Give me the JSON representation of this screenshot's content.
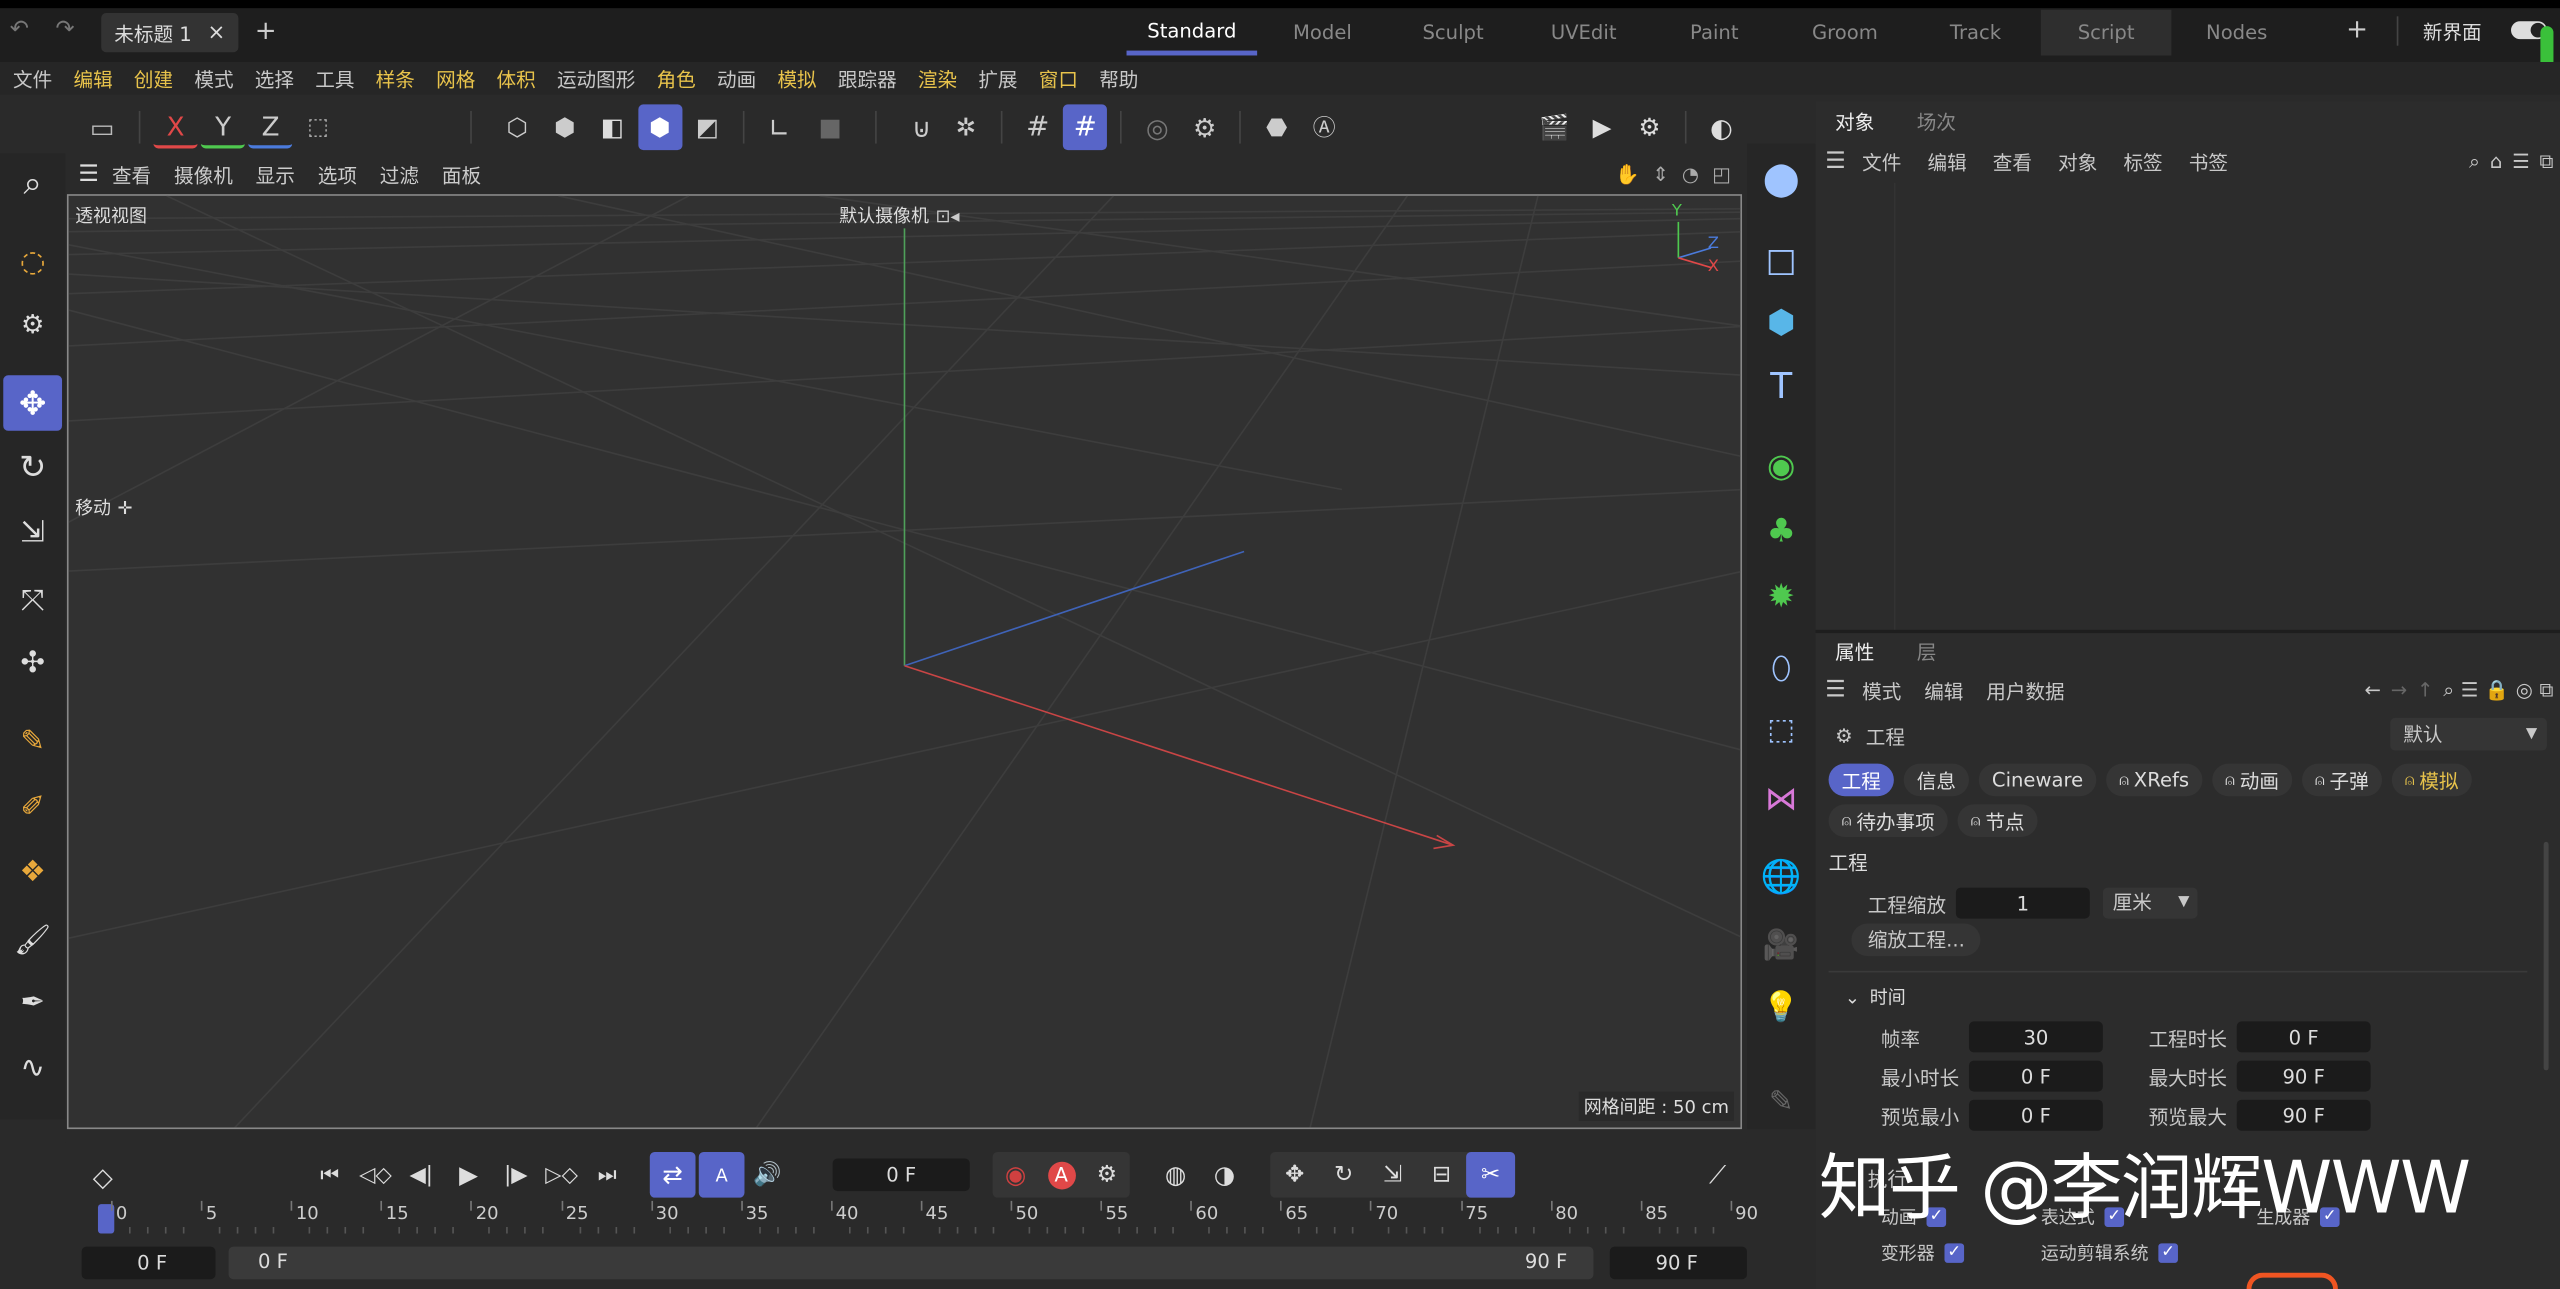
{
  "titlebar": {
    "doc_tab": "未标题 1",
    "close": "×",
    "add": "+",
    "layouts": [
      "Standard",
      "Model",
      "Sculpt",
      "UVEdit",
      "Paint",
      "Groom",
      "Track",
      "Script",
      "Nodes"
    ],
    "active_layout": "Standard",
    "add_layout": "+",
    "new_ui": "新界面"
  },
  "menubar": {
    "items": [
      "文件",
      "编辑",
      "创建",
      "模式",
      "选择",
      "工具",
      "样条",
      "网格",
      "体积",
      "运动图形",
      "角色",
      "动画",
      "模拟",
      "跟踪器",
      "渲染",
      "扩展",
      "窗口",
      "帮助"
    ],
    "highlighted": [
      "编辑",
      "创建",
      "样条",
      "网格",
      "体积",
      "角色",
      "模拟",
      "渲染",
      "窗口"
    ]
  },
  "toolbar": {
    "axes": [
      "X",
      "Y",
      "Z"
    ]
  },
  "viewport": {
    "menu": [
      "查看",
      "摄像机",
      "显示",
      "选项",
      "过滤",
      "面板"
    ],
    "view_name": "透视视图",
    "camera": "默认摄像机",
    "camera_glyph": "⊡◂",
    "tool_hint": "移动",
    "grid_label": "网格间距 : 50 cm",
    "axis_y": "Y",
    "axis_z": "Z",
    "axis_x": "X"
  },
  "objects_panel": {
    "tabs": [
      "对象",
      "场次"
    ],
    "menu": [
      "文件",
      "编辑",
      "查看",
      "对象",
      "标签",
      "书签"
    ]
  },
  "attributes_panel": {
    "tabs": [
      "属性",
      "层"
    ],
    "menu": [
      "模式",
      "编辑",
      "用户数据"
    ],
    "title": "工程",
    "preset": "默认",
    "tabs_row1": [
      "工程",
      "信息",
      "Cineware",
      "XRefs",
      "动画",
      "子弹",
      "模拟"
    ],
    "tabs_row2": [
      "待办事项",
      "节点"
    ],
    "section": "工程",
    "scale_label": "工程缩放",
    "scale_value": "1",
    "scale_unit": "厘米",
    "scale_btn": "缩放工程...",
    "time_section": "时间",
    "fields": [
      {
        "l": "帧率",
        "v": "30"
      },
      {
        "l": "工程时长",
        "v": "0 F"
      },
      {
        "l": "最小时长",
        "v": "0 F"
      },
      {
        "l": "最大时长",
        "v": "90 F"
      },
      {
        "l": "预览最小",
        "v": "0 F"
      },
      {
        "l": "预览最大",
        "v": "90 F"
      }
    ],
    "execute": "执行",
    "checks": [
      {
        "l": "动画"
      },
      {
        "l": "表达式"
      },
      {
        "l": "生成器"
      },
      {
        "l": "变形器"
      },
      {
        "l": "运动剪辑系统"
      }
    ]
  },
  "timeline": {
    "current_frame": "0 F",
    "ticks": [
      "0",
      "5",
      "10",
      "15",
      "20",
      "25",
      "30",
      "35",
      "40",
      "45",
      "50",
      "55",
      "60",
      "65",
      "70",
      "75",
      "80",
      "85",
      "90"
    ],
    "start": "0 F",
    "range_start": "0 F",
    "range_end": "90 F",
    "end": "90 F"
  },
  "watermark": "知乎 @李润辉WWW",
  "colors": {
    "accent": "#5865c8",
    "x": "#e04848",
    "y": "#4fc94f",
    "z": "#4b7bdc",
    "highlight_menu": "#e8c34b"
  }
}
